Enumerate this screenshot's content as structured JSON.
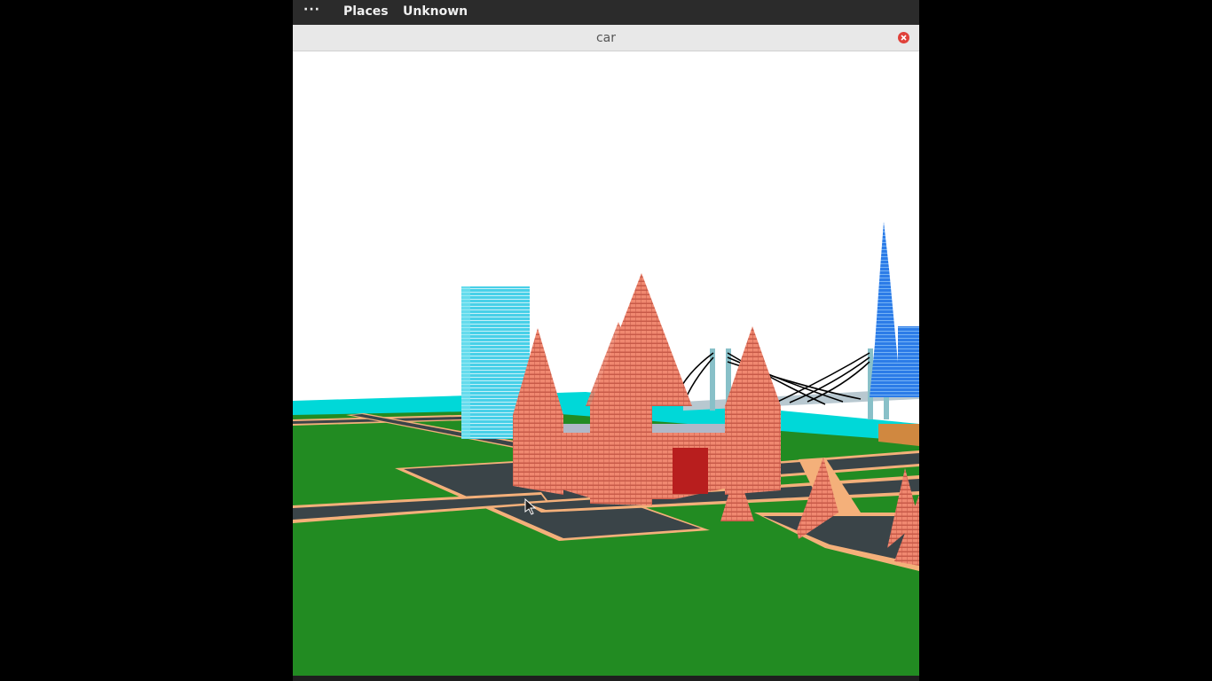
{
  "topbar": {
    "menu_dots": "···",
    "places_label": "Places",
    "unknown_label": "Unknown"
  },
  "window": {
    "title": "car"
  },
  "icons": {
    "close": "close-icon",
    "cursor": "mouse-pointer-icon"
  },
  "colors": {
    "sky": "#ffffff",
    "grass": "#228b22",
    "road": "#3a4448",
    "road_border": "#f4b07a",
    "temple": "#f08870",
    "temple_door": "#b81e1e",
    "water": "#00d8d8",
    "skyscraper": "#40c8e0",
    "bridge_cable": "#000000",
    "tower_blue": "#2878e8",
    "close_button": "#e0413a"
  }
}
